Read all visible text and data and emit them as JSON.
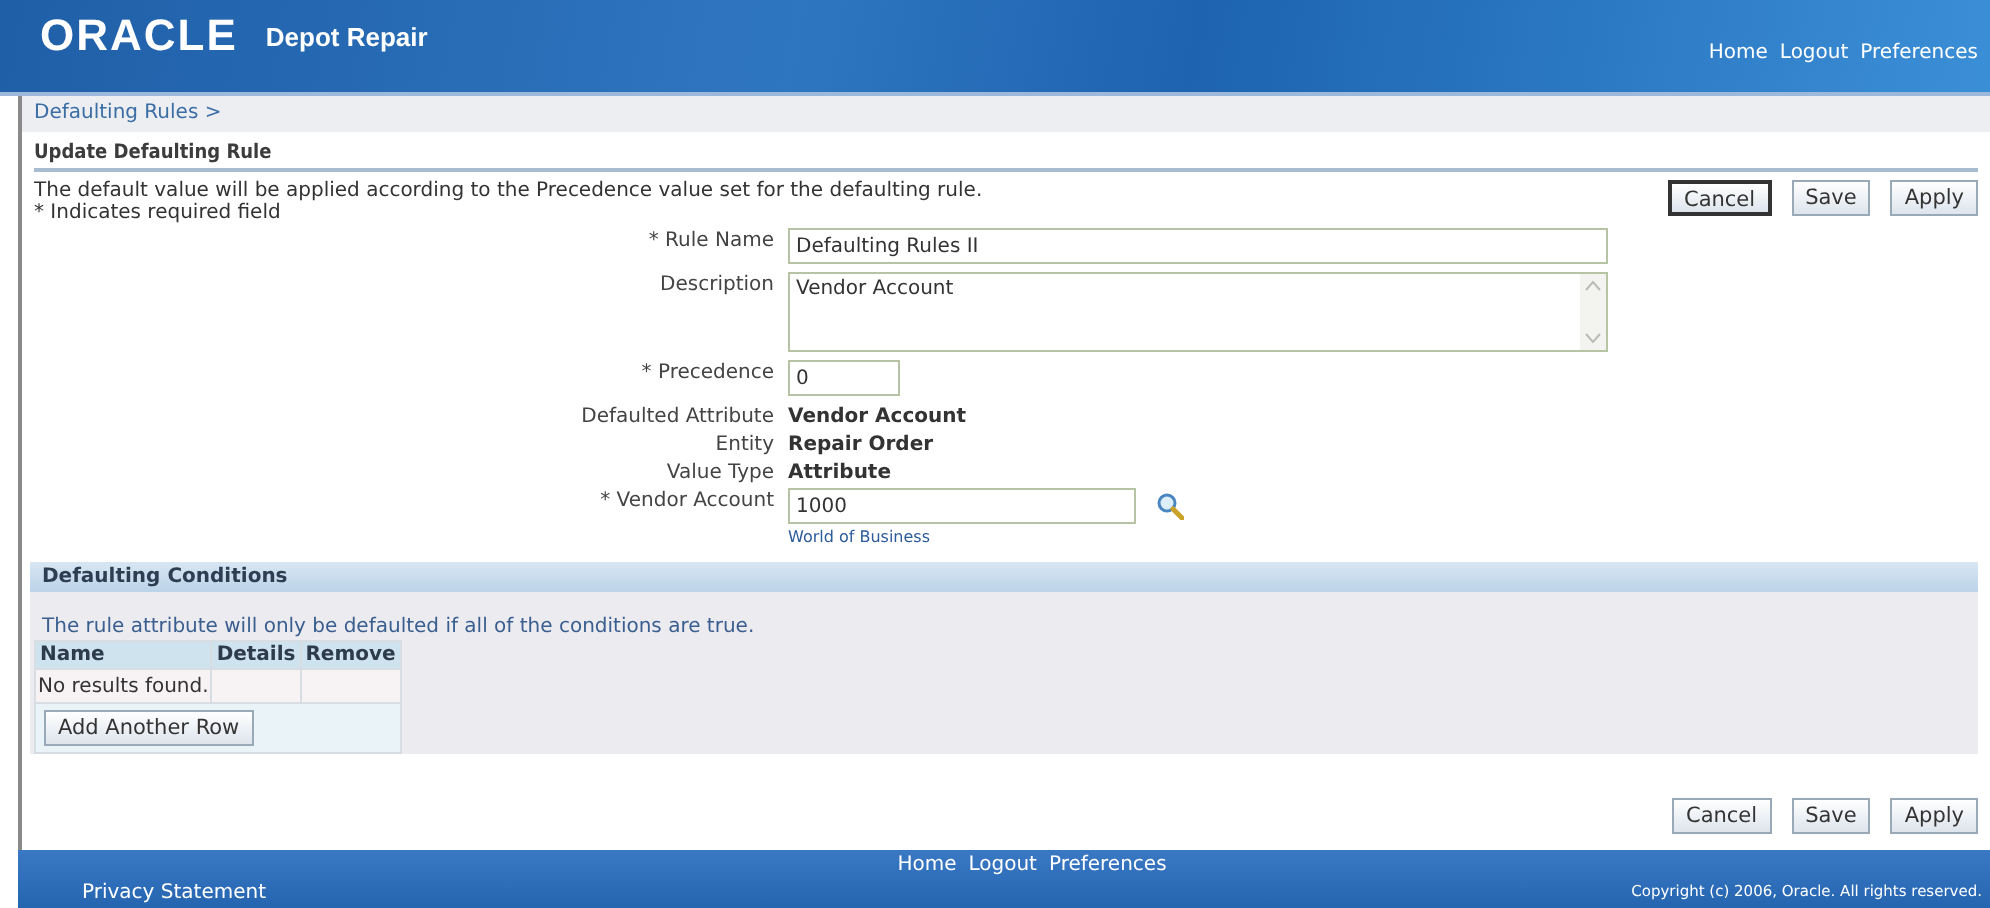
{
  "header": {
    "logo": "ORACLE",
    "app_title": "Depot Repair",
    "links": [
      "Home",
      "Logout",
      "Preferences"
    ]
  },
  "breadcrumb": "Defaulting Rules  >",
  "page_title": "Update Defaulting Rule",
  "instruction": "The default value will be applied according to the Precedence value set for the defaulting rule.",
  "required_note": "* Indicates required field",
  "top_buttons": [
    {
      "label": "Cancel",
      "focused": true
    },
    {
      "label": "Save",
      "focused": false
    },
    {
      "label": "Apply",
      "focused": false
    }
  ],
  "fields": [
    {
      "kind": "text",
      "label": "* Rule Name",
      "value": "Defaulting Rules II"
    },
    {
      "kind": "textarea",
      "label": "Description",
      "value": "Vendor Account"
    },
    {
      "kind": "number",
      "label": "* Precedence",
      "value": "0"
    },
    {
      "kind": "readonly",
      "label": "Defaulted Attribute",
      "value": "Vendor Account"
    },
    {
      "kind": "readonly",
      "label": "Entity",
      "value": "Repair Order"
    },
    {
      "kind": "readonly",
      "label": "Value Type",
      "value": "Attribute"
    },
    {
      "kind": "lookup",
      "label": "* Vendor Account",
      "value": "1000",
      "hint": "World of Business"
    }
  ],
  "conditions": {
    "title": "Defaulting Conditions",
    "note": "The rule attribute will only be defaulted if all of the conditions are true.",
    "columns": [
      "Name",
      "Details",
      "Remove"
    ],
    "empty_text": "No results found.",
    "add_button": "Add Another Row"
  },
  "bottom_buttons": [
    {
      "label": "Cancel",
      "focused": false
    },
    {
      "label": "Save",
      "focused": false
    },
    {
      "label": "Apply",
      "focused": false
    }
  ],
  "footer": {
    "links": [
      "Home",
      "Logout",
      "Preferences"
    ],
    "privacy": "Privacy Statement",
    "copyright": "Copyright (c) 2006, Oracle. All rights reserved."
  }
}
